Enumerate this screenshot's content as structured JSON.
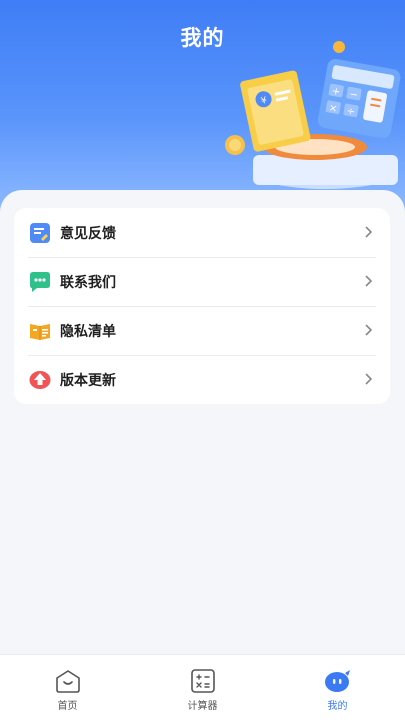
{
  "header": {
    "title": "我的"
  },
  "menu": [
    {
      "label": "意见反馈",
      "icon": "feedback-edit-icon"
    },
    {
      "label": "联系我们",
      "icon": "chat-bubble-icon"
    },
    {
      "label": "隐私清单",
      "icon": "privacy-list-icon"
    },
    {
      "label": "版本更新",
      "icon": "upgrade-arrow-icon"
    }
  ],
  "tabs": [
    {
      "label": "首页",
      "icon": "home-icon",
      "active": false
    },
    {
      "label": "计算器",
      "icon": "calculator-icon",
      "active": false
    },
    {
      "label": "我的",
      "icon": "mine-avatar-icon",
      "active": true
    }
  ],
  "colors": {
    "accent": "#3b7af5",
    "header_top": "#3f7df6",
    "background": "#f4f6f9"
  }
}
